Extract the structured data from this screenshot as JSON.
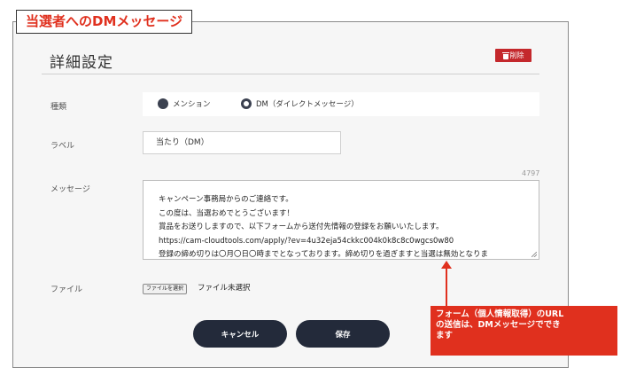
{
  "page_title": "当選者へのDMメッセージ",
  "section_heading": "詳細設定",
  "delete_button": {
    "label": "削除",
    "icon": "trash-icon"
  },
  "fields": {
    "type": {
      "label": "種類",
      "options": [
        {
          "label": "メンション",
          "selected": false
        },
        {
          "label": "DM（ダイレクトメッセージ）",
          "selected": true
        }
      ]
    },
    "label_field": {
      "label": "ラベル",
      "value": "当たり（DM）"
    },
    "message": {
      "label": "メッセージ",
      "remaining_count": "4797",
      "lines": [
        "キャンペーン事務局からのご連絡です。",
        "この度は、当選おめでとうございます！",
        "賞品をお送りしますので、以下フォームから送付先情報の登録をお願いいたします。",
        "https://cam-cloudtools.com/apply/?ev=4u32eja54ckkc004k0k8c8c0wgcs0w80",
        "登録の締め切りは〇月〇日〇時までとなっております。締め切りを過ぎますと当選は無効となりま"
      ]
    },
    "file": {
      "label": "ファイル",
      "button_label": "ファイルを選択",
      "status": "ファイル未選択"
    }
  },
  "buttons": {
    "cancel": "キャンセル",
    "save": "保存"
  },
  "annotation": {
    "lines": [
      "フォーム（個人情報取得）のURL",
      "の送信は、DMメッセージででき",
      "ます"
    ],
    "color": "#e0301e"
  }
}
